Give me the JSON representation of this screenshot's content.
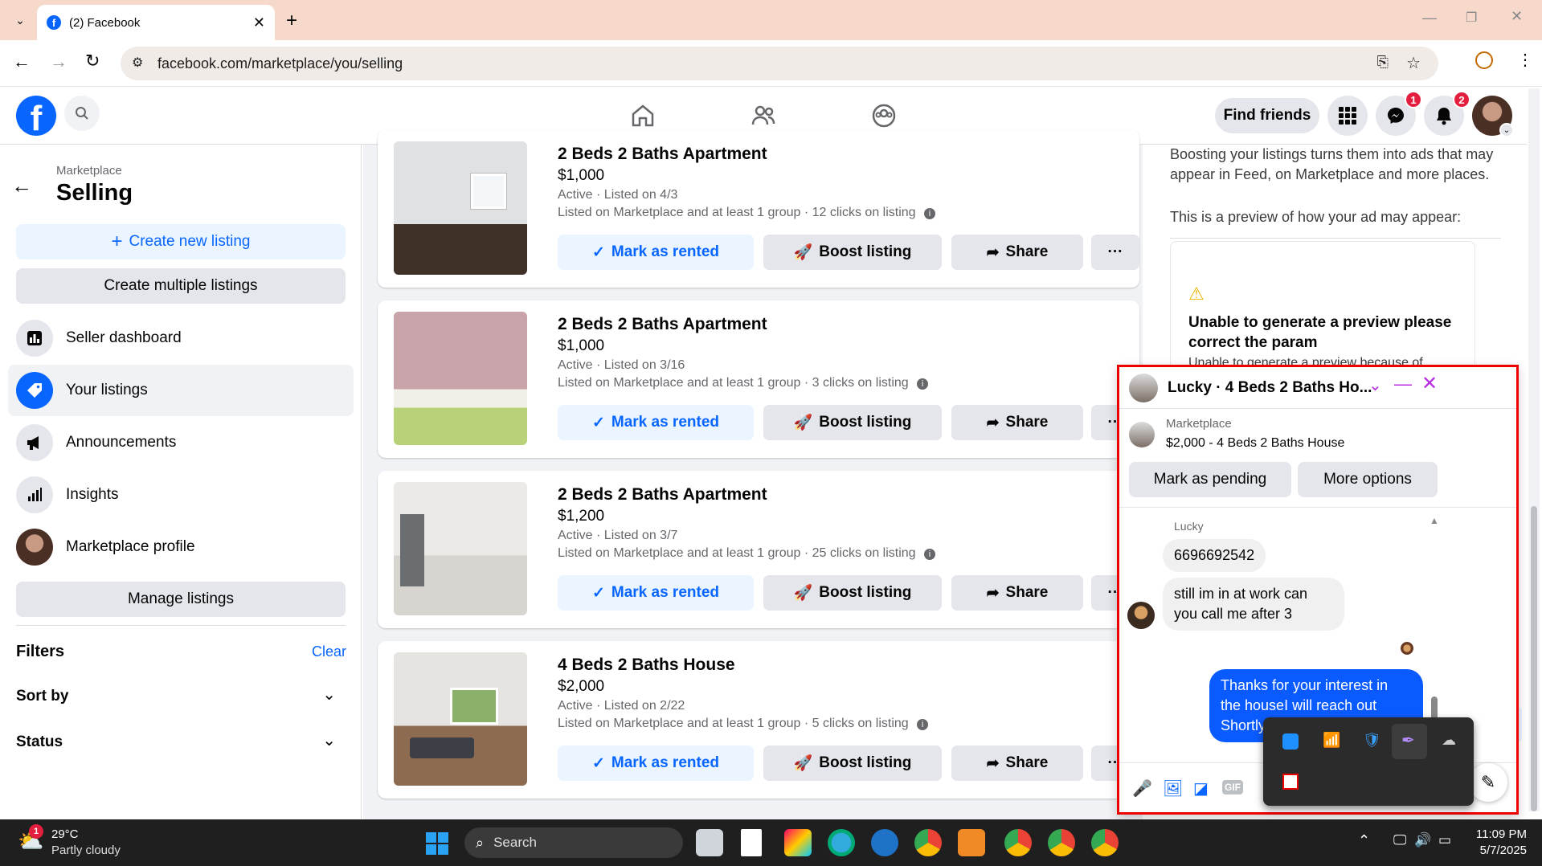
{
  "browser": {
    "tab_title": "(2) Facebook",
    "url": "facebook.com/marketplace/you/selling"
  },
  "header": {
    "find_friends": "Find friends",
    "messenger_badge": "1",
    "notifications_badge": "2"
  },
  "sidebar": {
    "section": "Marketplace",
    "title": "Selling",
    "create_new": "Create new listing",
    "create_multiple": "Create multiple listings",
    "items": [
      {
        "label": "Seller dashboard"
      },
      {
        "label": "Your listings"
      },
      {
        "label": "Announcements"
      },
      {
        "label": "Insights"
      },
      {
        "label": "Marketplace profile"
      }
    ],
    "manage": "Manage listings",
    "filters": "Filters",
    "clear": "Clear",
    "sort_by": "Sort by",
    "status": "Status"
  },
  "listings": [
    {
      "title": "2 Beds 2 Baths Apartment",
      "price": "$1,000",
      "status": "Active · Listed on 4/3",
      "meta": "Listed on Marketplace and at least 1 group · 12 clicks on listing"
    },
    {
      "title": "2 Beds 2 Baths Apartment",
      "price": "$1,000",
      "status": "Active · Listed on 3/16",
      "meta": "Listed on Marketplace and at least 1 group · 3 clicks on listing"
    },
    {
      "title": "2 Beds 2 Baths Apartment",
      "price": "$1,200",
      "status": "Active · Listed on 3/7",
      "meta": "Listed on Marketplace and at least 1 group · 25 clicks on listing"
    },
    {
      "title": "4 Beds 2 Baths House",
      "price": "$2,000",
      "status": "Active · Listed on 2/22",
      "meta": "Listed on Marketplace and at least 1 group · 5 clicks on listing"
    }
  ],
  "actions": {
    "mark_rented": "Mark as rented",
    "boost": "Boost listing",
    "share": "Share",
    "more": "···"
  },
  "boost_panel": {
    "intro": "Boosting your listings turns them into ads that may appear in Feed, on Marketplace and more places.",
    "preview_label": "This is a preview of how your ad may appear:",
    "error_title": "Unable to generate a preview please correct the param",
    "error_body": "Unable to generate a preview because of"
  },
  "chat": {
    "title": "Lucky · 4 Beds 2 Baths Ho...",
    "context_label": "Marketplace",
    "context_item": "$2,000 - 4 Beds 2 Baths House",
    "mark_pending": "Mark as pending",
    "more_options": "More options",
    "sender": "Lucky",
    "messages": [
      {
        "text": "6696692542",
        "from": "them"
      },
      {
        "text": "still im in at work can you call me after 3",
        "from": "them"
      },
      {
        "text": "Thanks for your interest in the houseI will reach out Shortly",
        "from": "me"
      }
    ]
  },
  "taskbar": {
    "temp": "29°C",
    "weather": "Partly cloudy",
    "weather_badge": "1",
    "search": "Search",
    "time": "11:09 PM",
    "date": "5/7/2025"
  },
  "colors": {
    "fb_blue": "#0866ff",
    "light_blue": "#ebf5ff",
    "gray_btn": "#e4e6eb",
    "messenger_bubble": "#0a5bff",
    "highlight_border": "#e00000"
  }
}
